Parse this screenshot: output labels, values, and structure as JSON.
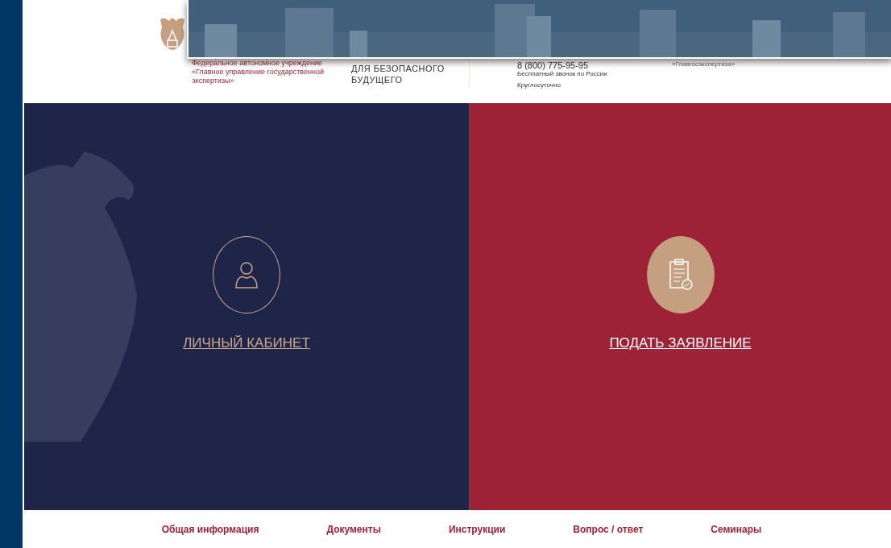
{
  "header": {
    "org_name": "Федеральное автономное учреждение «Главное управление государственной экспертизы»",
    "slogan": "ДЛЯ БЕЗОПАСНОГО БУДУЩЕГО",
    "phone": "8 (800) 775-95-95",
    "phone_note": "Бесплатный звонок по России",
    "hours": "Круглосуточно",
    "brand": "«Главгосэкспертиза»"
  },
  "tiles": [
    {
      "label": "ЛИЧНЫЙ КАБИНЕТ",
      "kind": "account"
    },
    {
      "label": "ПОДАТЬ ЗАЯВЛЕНИЕ",
      "kind": "application"
    }
  ],
  "nav": [
    "Общая информация",
    "Документы",
    "Инструкции",
    "Вопрос / ответ",
    "Семинары"
  ]
}
